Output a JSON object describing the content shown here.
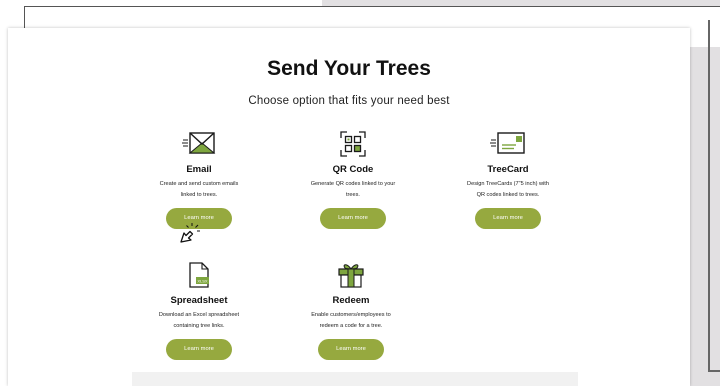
{
  "page": {
    "title": "Send Your Trees",
    "subtitle": "Choose option that fits your need best"
  },
  "options": [
    {
      "icon": "envelope-icon",
      "name": "Email",
      "desc_line1": "Create and send custom emails",
      "desc_line2": "linked to trees.",
      "button": "Learn more"
    },
    {
      "icon": "qr-code-icon",
      "name": "QR Code",
      "desc_line1": "Generate QR codes linked to your",
      "desc_line2": "trees.",
      "button": "Learn more"
    },
    {
      "icon": "treecard-icon",
      "name": "TreeCard",
      "desc_line1": "Design TreeCards (7\"5 inch) with",
      "desc_line2": "QR codes linked to trees.",
      "button": "Learn more"
    },
    {
      "icon": "spreadsheet-icon",
      "name": "Spreadsheet",
      "desc_line1": "Download an Excel spreadsheet",
      "desc_line2": "containing tree links.",
      "button": "Learn more"
    },
    {
      "icon": "gift-icon",
      "name": "Redeem",
      "desc_line1": "Enable customers/employees to",
      "desc_line2": "redeem a code for a tree.",
      "button": "Learn more"
    }
  ],
  "colors": {
    "accent": "#96a93f",
    "icon_green": "#7ea63f",
    "icon_outline": "#1a1a1a"
  }
}
